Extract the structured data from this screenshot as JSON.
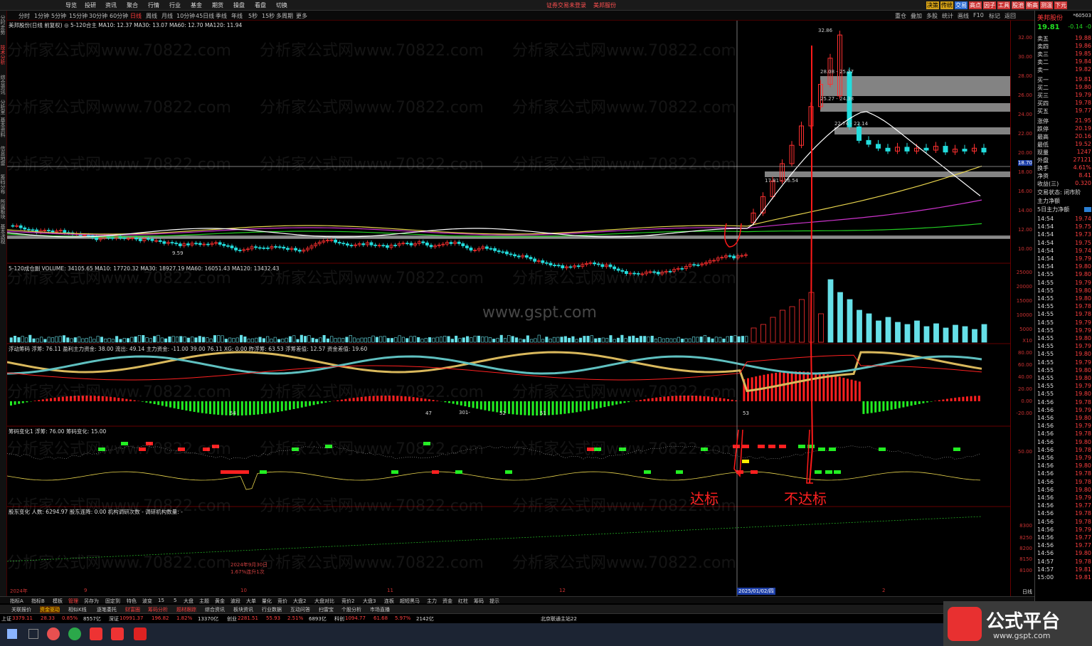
{
  "menu": [
    "导览",
    "投研",
    "资讯",
    "聚合",
    "行情",
    "行业",
    "基金",
    "期货",
    "操盘",
    "看盘",
    "切换"
  ],
  "menu_center": [
    "证券交易未登录",
    "美邦服份"
  ],
  "menu_right": [
    "决策",
    "传统",
    "交易",
    "高点",
    "因子",
    "工具",
    "股池",
    "新高",
    "测温",
    "下元"
  ],
  "periods": [
    "分时",
    "1分钟",
    "5分钟",
    "15分钟",
    "30分钟",
    "60分钟",
    "日线",
    "周线",
    "月线",
    "10分钟",
    "45日线",
    "季线",
    "年线",
    "5秒",
    "15秒",
    "多周期",
    "更多"
  ],
  "active_period": "日线",
  "toolbar_right": [
    "重仓",
    "叠加",
    "多股",
    "统计",
    "画线",
    "F10",
    "标记",
    "返回"
  ],
  "left_tabs": [
    "分时走势",
    "技术分析",
    "综合资讯",
    "分析室",
    "基本资料",
    "信息地雷",
    "筹码分布",
    "所属板块",
    "基本透视"
  ],
  "pane1_title": "美邦股份(日线 前复权) ◎ 5-120合主  MA10: 12.37  MA30: 13.07  MA60: 12.70  MA120: 11.94",
  "pane2_title": "5-120成仓副  VOLUME: 34105.65  MA10: 17720.32  MA30: 18927.19  MA60: 16051.43  MA120: 13432.43",
  "pane3_title": "浮动筹码  浮筹: 76.11  盈利主力资金: 38.00  流出: 49.14  主力资金: -11.00  39.00  76.11  XG: 0.00  昨浮筹: 63.53  浮筹差值: 12.57  资金差值: 19.60",
  "pane4_title": "筹码变化1  浮筹: 76.00  筹码变化: 15.00",
  "pane5_title": "股东变化  人数: 6294.97  股东连降: 0.00  机构调研次数 - 调研机构数量: -",
  "price_labels": [
    "32.86",
    "28.08 - 25.27",
    "25.27 - 24.38",
    "22.74 - 22.14",
    "17.81 - 16.54",
    "9.59"
  ],
  "date_label": "2025/01/02/四",
  "axis_bottom": [
    "2024年",
    "9",
    "10",
    "11",
    "12",
    "2"
  ],
  "annot_reach": "达标",
  "annot_notreach": "不达标",
  "annot_small": "2024年9月30日\n1.67%连升1次",
  "chip_nums": [
    "54",
    "47",
    "301-",
    "52",
    "51",
    "53"
  ],
  "y_axis_price": [
    "32.00",
    "30.00",
    "28.00",
    "26.00",
    "24.00",
    "22.00",
    "20.00",
    "18.70",
    "18.00",
    "16.00",
    "14.00",
    "12.00",
    "10.00"
  ],
  "y_axis_vol": [
    "25000",
    "20000",
    "15000",
    "10000",
    "5000",
    "X10"
  ],
  "y_axis_osc": [
    "80.00",
    "60.00",
    "40.00",
    "20.00",
    "0.00",
    "-20.00"
  ],
  "y_axis_chip": [
    "50.00"
  ],
  "y_axis_holder": [
    "8300",
    "8250",
    "8200",
    "8150",
    "8100",
    "日线"
  ],
  "quote": {
    "name": "美邦股份",
    "code": "*60503",
    "price": "19.81",
    "change": "-0.14",
    "pct": "-0",
    "asks": [
      [
        "卖五",
        "19.88"
      ],
      [
        "卖四",
        "19.86"
      ],
      [
        "卖三",
        "19.85"
      ],
      [
        "卖二",
        "19.84"
      ],
      [
        "卖一",
        "19.82"
      ]
    ],
    "bids": [
      [
        "买一",
        "19.81"
      ],
      [
        "买二",
        "19.80"
      ],
      [
        "买三",
        "19.79"
      ],
      [
        "买四",
        "19.78"
      ],
      [
        "买五",
        "19.77"
      ]
    ],
    "stats": [
      [
        "涨停",
        "21.95"
      ],
      [
        "跌停",
        "20.19"
      ],
      [
        "最高",
        "20.16"
      ],
      [
        "最低",
        "19.52"
      ],
      [
        "现量",
        "1247"
      ],
      [
        "外盘",
        "27121"
      ],
      [
        "换手",
        "4.61%"
      ],
      [
        "净资",
        "8.41"
      ],
      [
        "收益(三)",
        "0.320"
      ]
    ],
    "status": "交易状态: 闭市阶",
    "main_flow": "主力净额",
    "main_flow5": "5日主力净额",
    "ticks": [
      [
        "14:54",
        "19.74"
      ],
      [
        "14:54",
        "19.75"
      ],
      [
        "14:54",
        "19.73"
      ],
      [
        "14:54",
        "19.75"
      ],
      [
        "14:54",
        "19.74"
      ],
      [
        "14:54",
        "19.79"
      ],
      [
        "14:54",
        "19.80"
      ],
      [
        "14:55",
        "19.80"
      ],
      [
        "14:55",
        "19.79"
      ],
      [
        "14:55",
        "19.80"
      ],
      [
        "14:55",
        "19.80"
      ],
      [
        "14:55",
        "19.78"
      ],
      [
        "14:55",
        "19.78"
      ],
      [
        "14:55",
        "19.79"
      ],
      [
        "14:55",
        "19.79"
      ],
      [
        "14:55",
        "19.80"
      ],
      [
        "14:55",
        "19.79"
      ],
      [
        "14:55",
        "19.80"
      ],
      [
        "14:55",
        "19.79"
      ],
      [
        "14:55",
        "19.80"
      ],
      [
        "14:55",
        "19.80"
      ],
      [
        "14:55",
        "19.79"
      ],
      [
        "14:55",
        "19.80"
      ],
      [
        "14:56",
        "19.78"
      ],
      [
        "14:56",
        "19.79"
      ],
      [
        "14:56",
        "19.80"
      ],
      [
        "14:56",
        "19.79"
      ],
      [
        "14:56",
        "19.78"
      ],
      [
        "14:56",
        "19.80"
      ],
      [
        "14:56",
        "19.78"
      ],
      [
        "14:56",
        "19.79"
      ],
      [
        "14:56",
        "19.80"
      ],
      [
        "14:56",
        "19.78"
      ],
      [
        "14:56",
        "19.78"
      ],
      [
        "14:56",
        "19.80"
      ],
      [
        "14:56",
        "19.79"
      ],
      [
        "14:56",
        "19.77"
      ],
      [
        "14:56",
        "19.78"
      ],
      [
        "14:56",
        "19.78"
      ],
      [
        "14:56",
        "19.79"
      ],
      [
        "14:56",
        "19.77"
      ],
      [
        "14:56",
        "19.77"
      ],
      [
        "14:56",
        "19.80"
      ],
      [
        "14:57",
        "19.78"
      ],
      [
        "14:57",
        "19.81"
      ],
      [
        "15:00",
        "19.81"
      ]
    ]
  },
  "bottom_tabs": [
    "指标A",
    "指标B",
    "模板",
    "管理",
    "另存为",
    "固定到",
    "特色",
    "波变",
    "15",
    "5",
    "大盘",
    "主题",
    "黄金",
    "波段",
    "大单",
    "量化",
    "竞价",
    "大盘2",
    "大盘对比",
    "竞价2",
    "大盘3",
    "连板",
    "超短黑马",
    "主力",
    "资金",
    "红柱",
    "筹码",
    "提示"
  ],
  "bottom_tabs2": [
    "关联报价",
    "资金驱动",
    "相似K线",
    "逐笔委托",
    "财富圈",
    "筹码分析",
    "题材跟踪",
    "综合资讯",
    "板块资讯",
    "行业数据",
    "互动问答",
    "扫雷宝",
    "个股分析",
    "市场直播"
  ],
  "status_items": [
    {
      "label": "上证",
      "val": "3379.11",
      "chg": "28.33",
      "pct": "0.85%",
      "amt": "8557亿"
    },
    {
      "label": "深证",
      "val": "10991.37",
      "chg": "196.82",
      "pct": "1.82%",
      "amt": "13370亿"
    },
    {
      "label": "创业",
      "val": "2281.51",
      "chg": "55.93",
      "pct": "2.51%",
      "amt": "6893亿"
    },
    {
      "label": "科创",
      "val": "1094.77",
      "chg": "61.68",
      "pct": "5.97%",
      "amt": "2142亿"
    }
  ],
  "server": "北京联通主站22",
  "watermark": "分析家公式网www.70822.com",
  "watermark2": "www.gspt.com",
  "brand_big": "公式平台",
  "brand_small": "www.gspt.com",
  "colors": {
    "accent": "#ff3b3b",
    "ma_white": "#ffffff",
    "ma_yellow": "#e8d44d",
    "ma_magenta": "#cc33cc",
    "ma_green": "#22cc22",
    "vol_cyan": "#66e0e8",
    "osc_red": "#ff2020",
    "osc_green": "#22ee22"
  }
}
